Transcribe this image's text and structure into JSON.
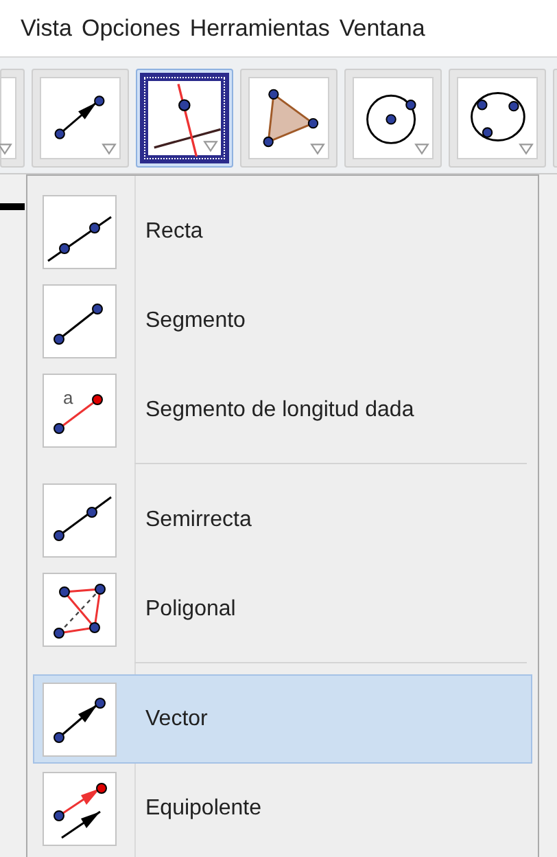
{
  "menu_bar": [
    "Vista",
    "Opciones",
    "Herramientas",
    "Ventana"
  ],
  "toolbar": [
    {
      "kind": "clipped",
      "selected": false
    },
    {
      "kind": "vector",
      "selected": false
    },
    {
      "kind": "perpendicular",
      "selected": true
    },
    {
      "kind": "polygon",
      "selected": false
    },
    {
      "kind": "circle-center",
      "selected": false
    },
    {
      "kind": "circle-three",
      "selected": false
    },
    {
      "kind": "clipped",
      "selected": false
    }
  ],
  "tool_menu": {
    "groups": [
      [
        {
          "kind": "line",
          "label": "Recta",
          "selected": false
        },
        {
          "kind": "segment",
          "label": "Segmento",
          "selected": false
        },
        {
          "kind": "segment-length",
          "label": "Segmento de longitud dada",
          "icon_text": "a",
          "selected": false
        }
      ],
      [
        {
          "kind": "ray",
          "label": "Semirrecta",
          "selected": false
        },
        {
          "kind": "polyline",
          "label": "Poligonal",
          "selected": false
        }
      ],
      [
        {
          "kind": "vector",
          "label": "Vector",
          "selected": true
        },
        {
          "kind": "vector-from-point",
          "label": "Equipolente",
          "selected": false
        }
      ]
    ]
  }
}
